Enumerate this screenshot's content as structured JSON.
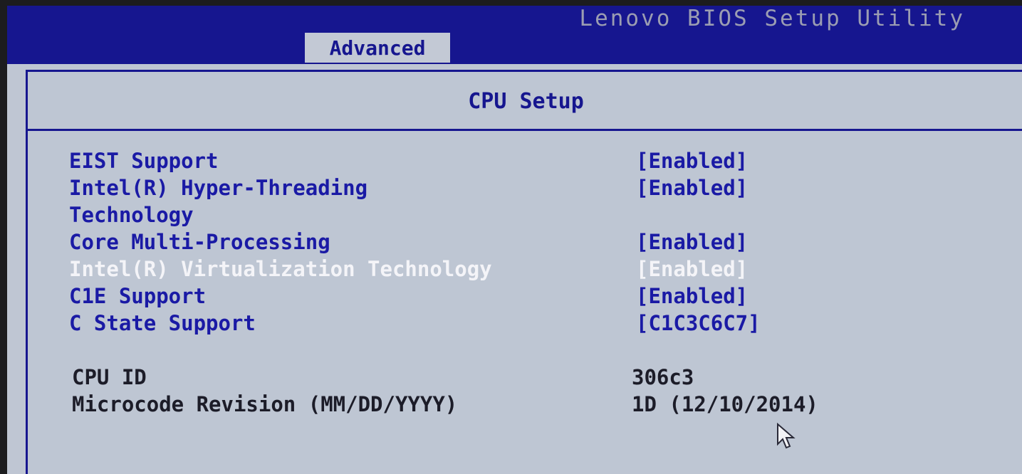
{
  "app": {
    "title": "Lenovo BIOS Setup Utility"
  },
  "tabs": {
    "active_label": "Advanced"
  },
  "page": {
    "title": "CPU Setup"
  },
  "settings": [
    {
      "label": "EIST Support",
      "value": "[Enabled]"
    },
    {
      "label": "Intel(R) Hyper-Threading",
      "value": "[Enabled]"
    },
    {
      "label": "Technology",
      "value": ""
    },
    {
      "label": "Core Multi-Processing",
      "value": "[Enabled]"
    },
    {
      "label": "Intel(R) Virtualization Technology",
      "value": "[Enabled]"
    },
    {
      "label": "C1E Support",
      "value": "[Enabled]"
    },
    {
      "label": "C State Support",
      "value": "[C1C3C6C7]"
    }
  ],
  "info": [
    {
      "label": "CPU ID",
      "value": "306c3"
    },
    {
      "label": "Microcode Revision (MM/DD/YYYY)",
      "value": "1D (12/10/2014)"
    }
  ],
  "colors": {
    "header_blue": "#16168f",
    "panel_gray": "#bfc6d3",
    "item_blue": "#1a1aa5",
    "selected_text": "#f4f4f8"
  },
  "icons": {
    "pointer": "mouse-pointer-icon"
  }
}
